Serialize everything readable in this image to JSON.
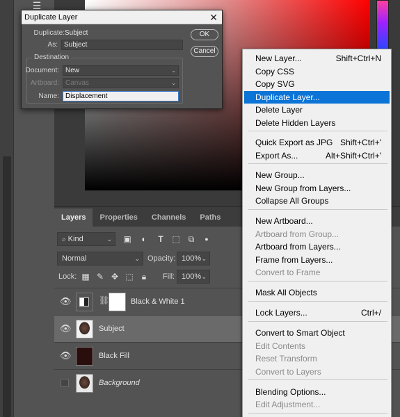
{
  "dialog": {
    "title": "Duplicate Layer",
    "duplicate_label": "Duplicate:",
    "duplicate_value": "Subject",
    "as_label": "As:",
    "as_value": "Subject",
    "destination_label": "Destination",
    "document_label": "Document:",
    "document_value": "New",
    "artboard_label": "Artboard:",
    "artboard_value": "Canvas",
    "name_label": "Name:",
    "name_value": "Displacement",
    "ok_label": "OK",
    "cancel_label": "Cancel"
  },
  "panel": {
    "tabs": [
      "Layers",
      "Properties",
      "Channels",
      "Paths"
    ],
    "filter_value": "Kind",
    "blend_mode": "Normal",
    "opacity_label": "Opacity:",
    "opacity_value": "100%",
    "lock_label": "Lock:",
    "fill_label": "Fill:",
    "fill_value": "100%"
  },
  "layers": [
    {
      "name": "Black & White 1",
      "visible": true,
      "selected": false
    },
    {
      "name": "Subject",
      "visible": true,
      "selected": true
    },
    {
      "name": "Black Fill",
      "visible": true,
      "selected": false
    },
    {
      "name": "Background",
      "visible": false,
      "selected": false
    }
  ],
  "menu": {
    "items": [
      {
        "label": "New Layer...",
        "shortcut": "Shift+Ctrl+N",
        "disabled": false
      },
      {
        "label": "Copy CSS",
        "shortcut": "",
        "disabled": false
      },
      {
        "label": "Copy SVG",
        "shortcut": "",
        "disabled": false
      },
      {
        "label": "Duplicate Layer...",
        "shortcut": "",
        "disabled": false,
        "highlighted": true
      },
      {
        "label": "Delete Layer",
        "shortcut": "",
        "disabled": false
      },
      {
        "label": "Delete Hidden Layers",
        "shortcut": "",
        "disabled": false
      },
      {
        "label": "Quick Export as JPG",
        "shortcut": "Shift+Ctrl+'",
        "disabled": false
      },
      {
        "label": "Export As...",
        "shortcut": "Alt+Shift+Ctrl+'",
        "disabled": false
      },
      {
        "label": "New Group...",
        "shortcut": "",
        "disabled": false
      },
      {
        "label": "New Group from Layers...",
        "shortcut": "",
        "disabled": false
      },
      {
        "label": "Collapse All Groups",
        "shortcut": "",
        "disabled": false
      },
      {
        "label": "New Artboard...",
        "shortcut": "",
        "disabled": false
      },
      {
        "label": "Artboard from Group...",
        "shortcut": "",
        "disabled": true
      },
      {
        "label": "Artboard from Layers...",
        "shortcut": "",
        "disabled": false
      },
      {
        "label": "Frame from Layers...",
        "shortcut": "",
        "disabled": false
      },
      {
        "label": "Convert to Frame",
        "shortcut": "",
        "disabled": true
      },
      {
        "label": "Mask All Objects",
        "shortcut": "",
        "disabled": false
      },
      {
        "label": "Lock Layers...",
        "shortcut": "Ctrl+/",
        "disabled": false
      },
      {
        "label": "Convert to Smart Object",
        "shortcut": "",
        "disabled": false
      },
      {
        "label": "Edit Contents",
        "shortcut": "",
        "disabled": true
      },
      {
        "label": "Reset Transform",
        "shortcut": "",
        "disabled": true
      },
      {
        "label": "Convert to Layers",
        "shortcut": "",
        "disabled": true
      },
      {
        "label": "Blending Options...",
        "shortcut": "",
        "disabled": false
      },
      {
        "label": "Edit Adjustment...",
        "shortcut": "",
        "disabled": true
      }
    ]
  },
  "colors": {
    "menu_highlight": "#0c74d6",
    "panel_bg": "#535353",
    "menu_bg": "#f0f0f0"
  }
}
